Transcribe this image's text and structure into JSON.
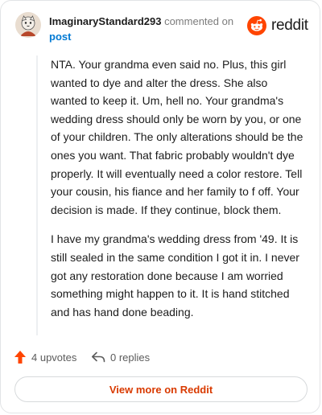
{
  "comment": {
    "username": "ImaginaryStandard293",
    "action_text": "commented on",
    "post_link": "post",
    "brand": "reddit",
    "paragraphs": [
      "NTA. Your grandma even said no. Plus, this girl wanted to dye and alter the dress. She also wanted to keep it. Um, hell no. Your grandma's wedding dress should only be worn by you, or one of your children. The only alterations should be the ones you want. That fabric probably wouldn't dye properly. It will eventually need a color restore. Tell your cousin, his fiance and her family to f off. Your decision is made. If they continue, block them.",
      "I have my grandma's wedding dress from '49. It is still sealed in the same condition I got it in. I never got any restoration done because I am worried something might happen to it. It is hand stitched and has hand done beading."
    ],
    "upvotes": "4 upvotes",
    "replies": "0 replies",
    "view_more": "View more on Reddit"
  },
  "colors": {
    "accent": "#d93a00",
    "link": "#0079d3",
    "upvote": "#ff4500"
  },
  "icons": [
    "avatar",
    "reddit-logo-icon",
    "upvote-arrow-icon",
    "reply-icon"
  ]
}
